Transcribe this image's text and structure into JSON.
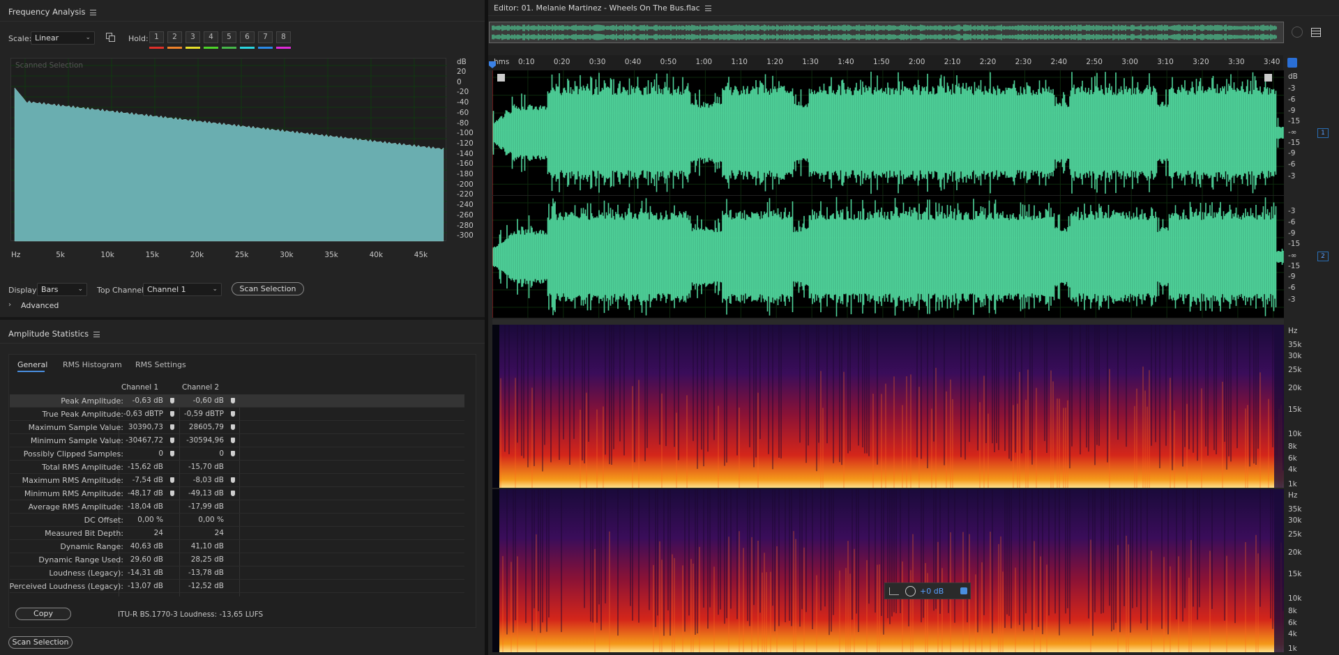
{
  "freq": {
    "title": "Frequency Analysis",
    "scale_label": "Scale:",
    "scale_value": "Linear",
    "hold_label": "Hold:",
    "hold_buttons": [
      "1",
      "2",
      "3",
      "4",
      "5",
      "6",
      "7",
      "8"
    ],
    "hold_colors": [
      "#e0302a",
      "#f0822a",
      "#e8e02a",
      "#4ed42a",
      "#46b84a",
      "#2ad6e0",
      "#2a8ae8",
      "#e02ad8"
    ],
    "overlay": "Scanned Selection",
    "db_unit": "dB",
    "db_ticks": [
      "20",
      "0",
      "-20",
      "-40",
      "-60",
      "-80",
      "-100",
      "-120",
      "-140",
      "-160",
      "-180",
      "-200",
      "-220",
      "-240",
      "-260",
      "-280",
      "-300"
    ],
    "hz_ticks": [
      "Hz",
      "5k",
      "10k",
      "15k",
      "20k",
      "25k",
      "30k",
      "35k",
      "40k",
      "45k"
    ],
    "display_label": "Display:",
    "display_value": "Bars",
    "top_channel_label": "Top Channel:",
    "top_channel_value": "Channel 1",
    "scan_button": "Scan Selection",
    "advanced": "Advanced",
    "fill_color": "#6aaeb0"
  },
  "stats": {
    "title": "Amplitude Statistics",
    "tabs": [
      "General",
      "RMS Histogram",
      "RMS Settings"
    ],
    "col1": "Channel 1",
    "col2": "Channel 2",
    "rows": [
      {
        "label": "Peak Amplitude:",
        "c1": "-0,63 dB",
        "c2": "-0,60 dB",
        "marker": true
      },
      {
        "label": "True Peak Amplitude:",
        "c1": "-0,63 dBTP",
        "c2": "-0,59 dBTP",
        "marker": true
      },
      {
        "label": "Maximum Sample Value:",
        "c1": "30390,73",
        "c2": "28605,79",
        "marker": true
      },
      {
        "label": "Minimum Sample Value:",
        "c1": "-30467,72",
        "c2": "-30594,96",
        "marker": true
      },
      {
        "label": "Possibly Clipped Samples:",
        "c1": "0",
        "c2": "0",
        "marker": true
      },
      {
        "label": "Total RMS Amplitude:",
        "c1": "-15,62 dB",
        "c2": "-15,70 dB",
        "marker": false
      },
      {
        "label": "Maximum RMS Amplitude:",
        "c1": "-7,54 dB",
        "c2": "-8,03 dB",
        "marker": true
      },
      {
        "label": "Minimum RMS Amplitude:",
        "c1": "-48,17 dB",
        "c2": "-49,13 dB",
        "marker": true
      },
      {
        "label": "Average RMS Amplitude:",
        "c1": "-18,04 dB",
        "c2": "-17,99 dB",
        "marker": false
      },
      {
        "label": "DC Offset:",
        "c1": "0,00 %",
        "c2": "0,00 %",
        "marker": false
      },
      {
        "label": "Measured Bit Depth:",
        "c1": "24",
        "c2": "24",
        "marker": false
      },
      {
        "label": "Dynamic Range:",
        "c1": "40,63 dB",
        "c2": "41,10 dB",
        "marker": false
      },
      {
        "label": "Dynamic Range Used:",
        "c1": "29,60 dB",
        "c2": "28,25 dB",
        "marker": false
      },
      {
        "label": "Loudness (Legacy):",
        "c1": "-14,31 dB",
        "c2": "-13,78 dB",
        "marker": false
      },
      {
        "label": "Perceived Loudness (Legacy):",
        "c1": "-13,07 dB",
        "c2": "-12,52 dB",
        "marker": false
      }
    ],
    "copy_button": "Copy",
    "loudness_text": "ITU-R BS.1770-3 Loudness: -13,65 LUFS",
    "scan_button": "Scan Selection"
  },
  "editor": {
    "title": "Editor: 01. Melanie Martinez - Wheels On The Bus.flac",
    "time_ticks": [
      "hms",
      "0:10",
      "0:20",
      "0:30",
      "0:40",
      "0:50",
      "1:00",
      "1:10",
      "1:20",
      "1:30",
      "1:40",
      "1:50",
      "2:00",
      "2:10",
      "2:20",
      "2:30",
      "2:40",
      "2:50",
      "3:00",
      "3:10",
      "3:20",
      "3:30",
      "3:40"
    ],
    "db_unit": "dB",
    "db_ticks": [
      "-3",
      "-6",
      "-9",
      "-15",
      "-∞",
      "-15",
      "-9",
      "-6",
      "-3"
    ],
    "channel_badges": [
      "1",
      "2"
    ],
    "wave_color": "#4fd39a",
    "hz_unit": "Hz",
    "hz_ticks": [
      "35k",
      "30k",
      "25k",
      "20k",
      "15k",
      "10k",
      "8k",
      "6k",
      "4k",
      "1k"
    ],
    "gain_value": "+0 dB"
  }
}
